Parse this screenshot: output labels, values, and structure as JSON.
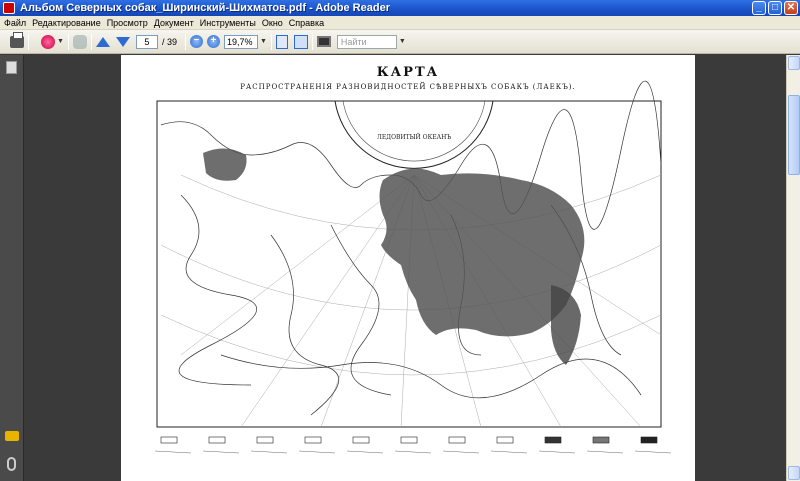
{
  "window": {
    "title": "Альбом Северных собак_Ширинский-Шихматов.pdf - Adobe Reader",
    "minimize": "_",
    "maximize": "□",
    "close": "✕"
  },
  "menu": [
    "Файл",
    "Редактирование",
    "Просмотр",
    "Документ",
    "Инструменты",
    "Окно",
    "Справка"
  ],
  "toolbar": {
    "page_current": "5",
    "page_total": "/ 39",
    "zoom_value": "19,7%",
    "zoom_out": "−",
    "zoom_in": "+",
    "search_placeholder": "Найти"
  },
  "document": {
    "heading": "КАРТА",
    "subheading": "РАСПРОСТРАНЕНІЯ РАЗНОВИДНОСТЕЙ СѢВЕРНЫХЪ СОБАКЪ (ЛАЕКЪ).",
    "ocean_label": "ЛЕДОВИТЫЙ ОКЕАНЪ",
    "legend_count": 11
  },
  "icons": {
    "print": "printer-icon",
    "sign": "sign-icon",
    "hand": "hand-icon",
    "prev": "arrow-up-icon",
    "next": "arrow-down-icon",
    "fit_page": "fit-page-icon",
    "fit_width": "fit-width-icon",
    "full_screen": "screen-icon",
    "pages_panel": "pages-icon",
    "comments_panel": "comment-icon",
    "attachments_panel": "paperclip-icon"
  }
}
